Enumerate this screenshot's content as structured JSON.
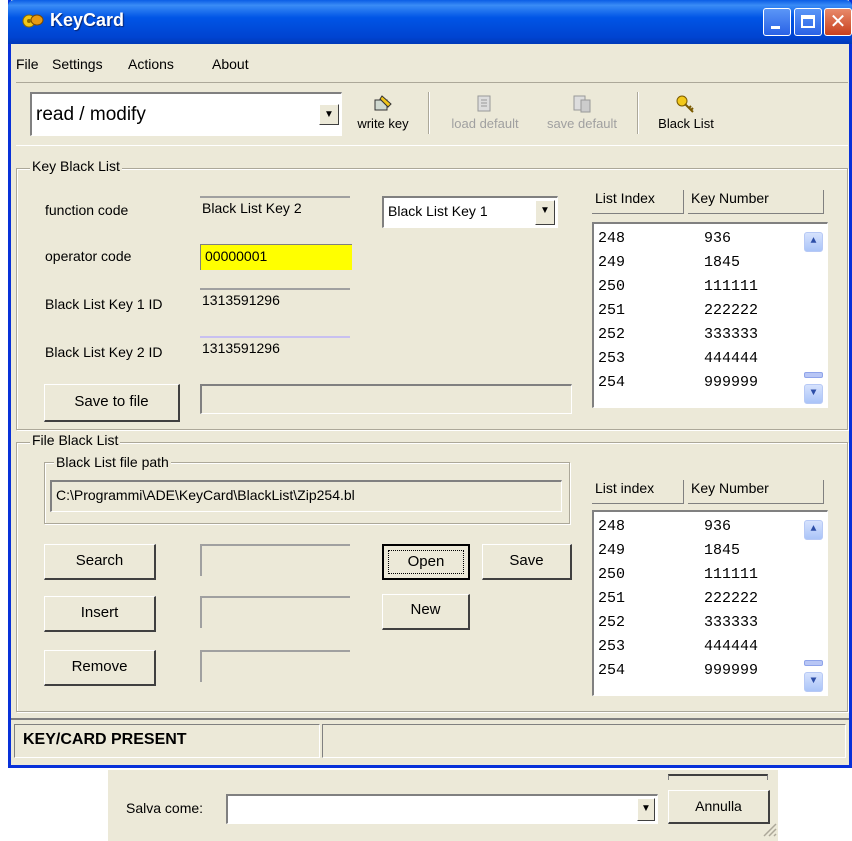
{
  "window": {
    "title": "KeyCard"
  },
  "menu": {
    "file": "File",
    "settings": "Settings",
    "actions": "Actions",
    "about": "About"
  },
  "toolbar": {
    "mode_value": "read / modify",
    "write_key": "write key",
    "load_default": "load default",
    "save_default": "save default",
    "black_list": "Black List"
  },
  "key_black_list": {
    "group_label": "Key Black List",
    "function_code_label": "function code",
    "function_code_value": "Black List Key 2",
    "function_select_value": "Black List Key 1",
    "operator_code_label": "operator code",
    "operator_code_value": "00000001",
    "key1_label": "Black List Key 1 ID",
    "key1_value": "1313591296",
    "key2_label": "Black List Key 2 ID",
    "key2_value": "1313591296",
    "save_button": "Save to file",
    "list": {
      "col_index": "List Index",
      "col_key": "Key Number",
      "rows": [
        {
          "index": "248",
          "key": "936"
        },
        {
          "index": "249",
          "key": "1845"
        },
        {
          "index": "250",
          "key": "111111"
        },
        {
          "index": "251",
          "key": "222222"
        },
        {
          "index": "252",
          "key": "333333"
        },
        {
          "index": "253",
          "key": "444444"
        },
        {
          "index": "254",
          "key": "999999"
        }
      ]
    }
  },
  "file_black_list": {
    "group_label": "File Black List",
    "path_group_label": "Black List file path",
    "path_value": "C:\\Programmi\\ADE\\KeyCard\\BlackList\\Zip254.bl",
    "search_button": "Search",
    "insert_button": "Insert",
    "remove_button": "Remove",
    "open_button": "Open",
    "new_button": "New",
    "save_button": "Save",
    "list": {
      "col_index": "List index",
      "col_key": "Key Number",
      "rows": [
        {
          "index": "248",
          "key": "936"
        },
        {
          "index": "249",
          "key": "1845"
        },
        {
          "index": "250",
          "key": "111111"
        },
        {
          "index": "251",
          "key": "222222"
        },
        {
          "index": "252",
          "key": "333333"
        },
        {
          "index": "253",
          "key": "444444"
        },
        {
          "index": "254",
          "key": "999999"
        }
      ]
    }
  },
  "status": {
    "text": "KEY/CARD PRESENT"
  },
  "save_dialog": {
    "save_as_label": "Salva come:",
    "cancel_button": "Annulla"
  },
  "colors": {
    "titlebar": "#0055e6",
    "highlight_field": "#ffff00",
    "window_bg": "#ece9d8"
  }
}
